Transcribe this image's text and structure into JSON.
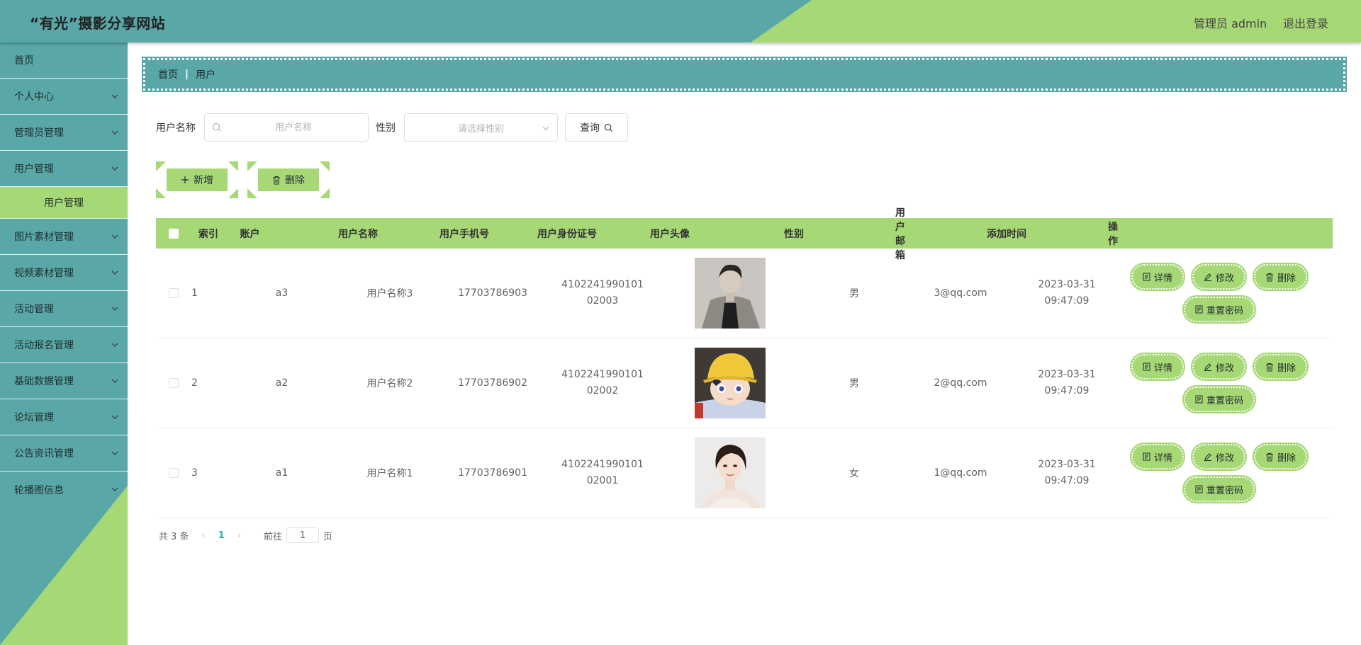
{
  "header": {
    "title": "“有光”摄影分享网站",
    "admin_label": "管理员 admin",
    "logout_label": "退出登录"
  },
  "sidebar": {
    "items": [
      {
        "label": "首页"
      },
      {
        "label": "个人中心"
      },
      {
        "label": "管理员管理"
      },
      {
        "label": "用户管理"
      },
      {
        "label": "图片素材管理"
      },
      {
        "label": "视频素材管理"
      },
      {
        "label": "活动管理"
      },
      {
        "label": "活动报名管理"
      },
      {
        "label": "基础数据管理"
      },
      {
        "label": "论坛管理"
      },
      {
        "label": "公告资讯管理"
      },
      {
        "label": "轮播图信息"
      }
    ],
    "active_sub": "用户管理"
  },
  "breadcrumb": {
    "home": "首页",
    "separator": "|",
    "current": "用户"
  },
  "search": {
    "name_label": "用户名称",
    "name_placeholder": "用户名称",
    "gender_label": "性别",
    "gender_placeholder": "请选择性别",
    "query_label": "查询"
  },
  "actions": {
    "add_label": "新增",
    "delete_label": "删除"
  },
  "table": {
    "headers": {
      "index": "索引",
      "account": "账户",
      "name": "用户名称",
      "phone": "用户手机号",
      "idcard": "用户身份证号",
      "avatar": "用户头像",
      "gender": "性别",
      "email": "用户邮箱",
      "time": "添加时间",
      "ops": "操作"
    },
    "ops_labels": {
      "detail": "详情",
      "edit": "修改",
      "delete": "删除",
      "reset": "重置密码"
    },
    "rows": [
      {
        "index": "1",
        "account": "a3",
        "name": "用户名称3",
        "phone": "17703786903",
        "idcard": "410224199010102003",
        "gender": "男",
        "email": "3@qq.com",
        "time": "2023-03-31 09:47:09"
      },
      {
        "index": "2",
        "account": "a2",
        "name": "用户名称2",
        "phone": "17703786902",
        "idcard": "410224199010102002",
        "gender": "男",
        "email": "2@qq.com",
        "time": "2023-03-31 09:47:09"
      },
      {
        "index": "3",
        "account": "a1",
        "name": "用户名称1",
        "phone": "17703786901",
        "idcard": "410224199010102001",
        "gender": "女",
        "email": "1@qq.com",
        "time": "2023-03-31 09:47:09"
      }
    ]
  },
  "pagination": {
    "total": "共 3 条",
    "current": "1",
    "goto_label": "前往",
    "goto_value": "1",
    "page_suffix": "页"
  },
  "colors": {
    "teal": "#5aa7a8",
    "green": "#a7d876",
    "active_page": "#2ab3a6"
  }
}
